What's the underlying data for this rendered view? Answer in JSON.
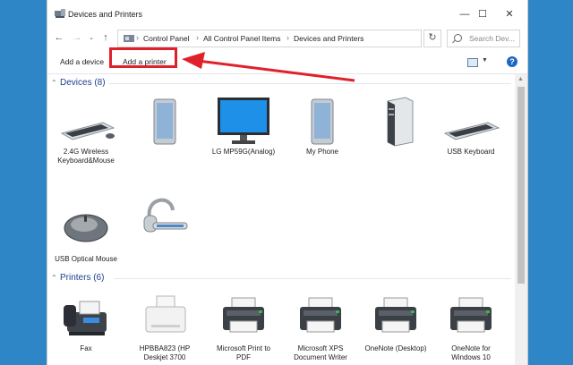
{
  "window": {
    "title": "Devices and Printers",
    "controls": {
      "minimize": "—",
      "maximize": "☐",
      "close": "✕"
    }
  },
  "address_bar": {
    "back": "←",
    "forward": "→",
    "up": "↑",
    "breadcrumbs": [
      "Control Panel",
      "All Control Panel Items",
      "Devices and Printers"
    ],
    "separator": "›",
    "refresh": "↻",
    "search_placeholder": "Search Dev..."
  },
  "command_bar": {
    "add_device": "Add a device",
    "add_printer": "Add a printer",
    "help": "?"
  },
  "groups": {
    "devices": {
      "title": "Devices (8)",
      "items": [
        {
          "label": "2.4G Wireless Keyboard&Mouse",
          "icon": "keyboard-icon"
        },
        {
          "label": "",
          "icon": "phone-icon"
        },
        {
          "label": "LG MP59G(Analog)",
          "icon": "monitor-icon"
        },
        {
          "label": "My Phone",
          "icon": "phone-icon"
        },
        {
          "label": "",
          "icon": "computer-tower-icon"
        },
        {
          "label": "USB Keyboard",
          "icon": "keyboard-icon"
        },
        {
          "label": "USB Optical Mouse",
          "icon": "mouse-icon"
        },
        {
          "label": "",
          "icon": "headset-icon"
        }
      ]
    },
    "printers": {
      "title": "Printers (6)",
      "items": [
        {
          "label": "Fax",
          "icon": "fax-icon"
        },
        {
          "label": "HPBBA823 (HP Deskjet 3700",
          "icon": "inkjet-printer-icon"
        },
        {
          "label": "Microsoft Print to PDF",
          "icon": "printer-icon"
        },
        {
          "label": "Microsoft XPS Document Writer",
          "icon": "printer-icon"
        },
        {
          "label": "OneNote (Desktop)",
          "icon": "printer-icon"
        },
        {
          "label": "OneNote for Windows 10",
          "icon": "printer-icon"
        }
      ]
    }
  },
  "colors": {
    "background": "#2f86c6",
    "highlight": "#e0202b",
    "group_heading": "#1e3f8c"
  }
}
